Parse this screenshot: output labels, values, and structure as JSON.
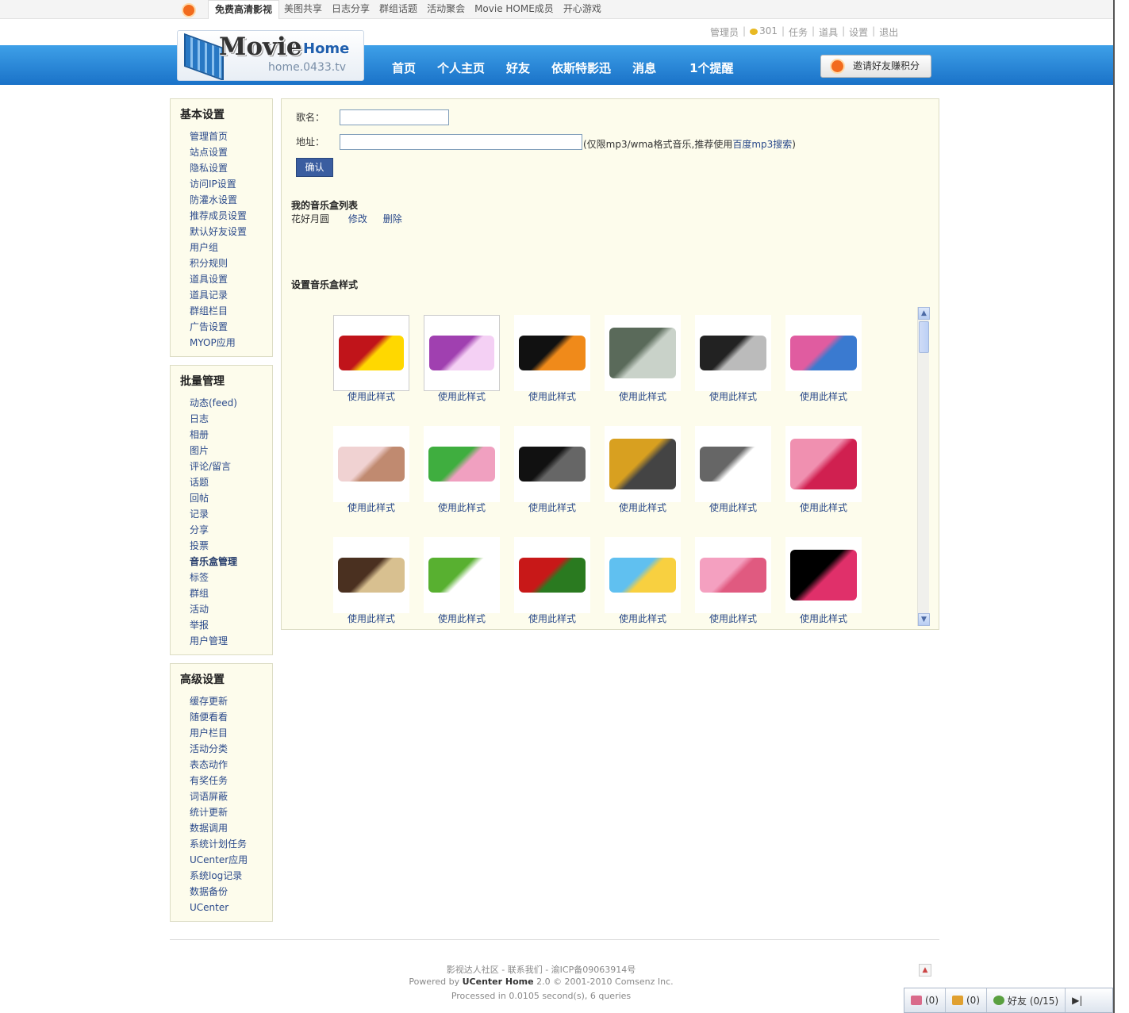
{
  "topbar": {
    "tabs": [
      "免费高清影视",
      "美图共享",
      "日志分享",
      "群组话题",
      "活动聚会",
      "Movie HOME成员",
      "开心游戏"
    ]
  },
  "userlinks": {
    "admin": "管理员",
    "credits": "301",
    "task": "任务",
    "props": "道具",
    "settings": "设置",
    "logout": "退出"
  },
  "logo": {
    "movie": "Movie",
    "home": "Home",
    "domain": "home.0433.tv"
  },
  "mainnav": [
    "首页",
    "个人主页",
    "好友",
    "依斯特影迅",
    "消息"
  ],
  "reminder": "1个提醒",
  "invite_label": "邀请好友赚积分",
  "sidebar": [
    {
      "title": "基本设置",
      "items": [
        "管理首页",
        "站点设置",
        "隐私设置",
        "访问IP设置",
        "防灌水设置",
        "推荐成员设置",
        "默认好友设置",
        "用户组",
        "积分规则",
        "道具设置",
        "道具记录",
        "群组栏目",
        "广告设置",
        "MYOP应用"
      ]
    },
    {
      "title": "批量管理",
      "items": [
        "动态(feed)",
        "日志",
        "相册",
        "图片",
        "评论/留言",
        "话题",
        "回帖",
        "记录",
        "分享",
        "投票",
        "音乐盒管理",
        "标签",
        "群组",
        "活动",
        "举报",
        "用户管理"
      ],
      "active": "音乐盒管理"
    },
    {
      "title": "高级设置",
      "items": [
        "缓存更新",
        "随便看看",
        "用户栏目",
        "活动分类",
        "表态动作",
        "有奖任务",
        "词语屏蔽",
        "统计更新",
        "数据调用",
        "系统计划任务",
        "UCenter应用",
        "系统log记录",
        "数据备份",
        "UCenter"
      ]
    }
  ],
  "form": {
    "song_label": "歌名：",
    "song_value": "",
    "url_label": "地址：",
    "url_value": "",
    "hint_prefix": "(仅限mp3/wma格式音乐,推荐使用",
    "hint_link": "百度mp3搜索",
    "hint_suffix": ")",
    "submit": "确认"
  },
  "musicbox": {
    "list_title": "我的音乐盒列表",
    "songs": [
      {
        "name": "花好月圆",
        "edit": "修改",
        "delete": "删除"
      }
    ]
  },
  "styles": {
    "title": "设置音乐盒样式",
    "use_label": "使用此样式",
    "items": [
      {
        "colors": [
          "#c0141a",
          "#ffd800"
        ]
      },
      {
        "colors": [
          "#a040b0",
          "#f4d0f4"
        ]
      },
      {
        "colors": [
          "#111111",
          "#f08a1a"
        ]
      },
      {
        "colors": [
          "#5a6a5a",
          "#c9d2c9"
        ]
      },
      {
        "colors": [
          "#222222",
          "#bbbbbb"
        ]
      },
      {
        "colors": [
          "#e05ca0",
          "#3a7ad0"
        ]
      },
      {
        "colors": [
          "#f0d2d2",
          "#c08a70"
        ]
      },
      {
        "colors": [
          "#3fae3f",
          "#f0a0c0"
        ]
      },
      {
        "colors": [
          "#111111",
          "#666666"
        ]
      },
      {
        "colors": [
          "#d8a020",
          "#444444"
        ]
      },
      {
        "colors": [
          "#666666",
          "#ffffff"
        ]
      },
      {
        "colors": [
          "#f090b0",
          "#d02050"
        ]
      },
      {
        "colors": [
          "#4a3020",
          "#d8c090"
        ]
      },
      {
        "colors": [
          "#58b030",
          "#ffffff"
        ]
      },
      {
        "colors": [
          "#c81818",
          "#2a7a20"
        ]
      },
      {
        "colors": [
          "#60c0f0",
          "#f8d040"
        ]
      },
      {
        "colors": [
          "#f4a0c0",
          "#e05a80"
        ]
      },
      {
        "colors": [
          "#000000",
          "#e0306a"
        ]
      }
    ]
  },
  "footer": {
    "links": "影视达人社区 - 联系我们 - 渝ICP备09063914号",
    "powered_prefix": "Powered by ",
    "powered_name": "UCenter Home",
    "powered_suffix": " 2.0 © 2001-2010 Comsenz Inc.",
    "processed": "Processed in 0.0105 second(s), 6 queries"
  },
  "dock": {
    "msg": "(0)",
    "group": "(0)",
    "friends": "好友 (0/15)"
  }
}
